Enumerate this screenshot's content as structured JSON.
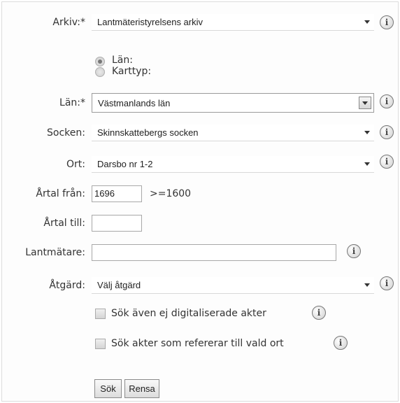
{
  "form": {
    "arkiv": {
      "label": "Arkiv:",
      "required": "*",
      "value": "Lantmäteristyrelsens arkiv"
    },
    "filter_options": [
      {
        "label": "Län:",
        "selected": true
      },
      {
        "label": "Karttyp:",
        "selected": false
      }
    ],
    "lan": {
      "label": "Län:",
      "required": "*",
      "value": "Västmanlands län"
    },
    "socken": {
      "label": "Socken:",
      "value": "Skinnskattebergs socken"
    },
    "ort": {
      "label": "Ort:",
      "value": "Darsbo nr 1-2"
    },
    "artal_fran": {
      "label": "Årtal från:",
      "value": "1696",
      "hint": ">=1600"
    },
    "artal_till": {
      "label": "Årtal till:",
      "value": ""
    },
    "lantmatare": {
      "label": "Lantmätare:",
      "value": ""
    },
    "atgard": {
      "label": "Åtgärd:",
      "value": "Välj åtgärd"
    },
    "checkboxes": [
      {
        "label": "Sök även ej digitaliserade akter",
        "checked": false
      },
      {
        "label": "Sök akter som refererar till vald ort",
        "checked": false
      }
    ],
    "buttons": {
      "search": "Sök",
      "clear": "Rensa"
    },
    "info_glyph": "i"
  }
}
